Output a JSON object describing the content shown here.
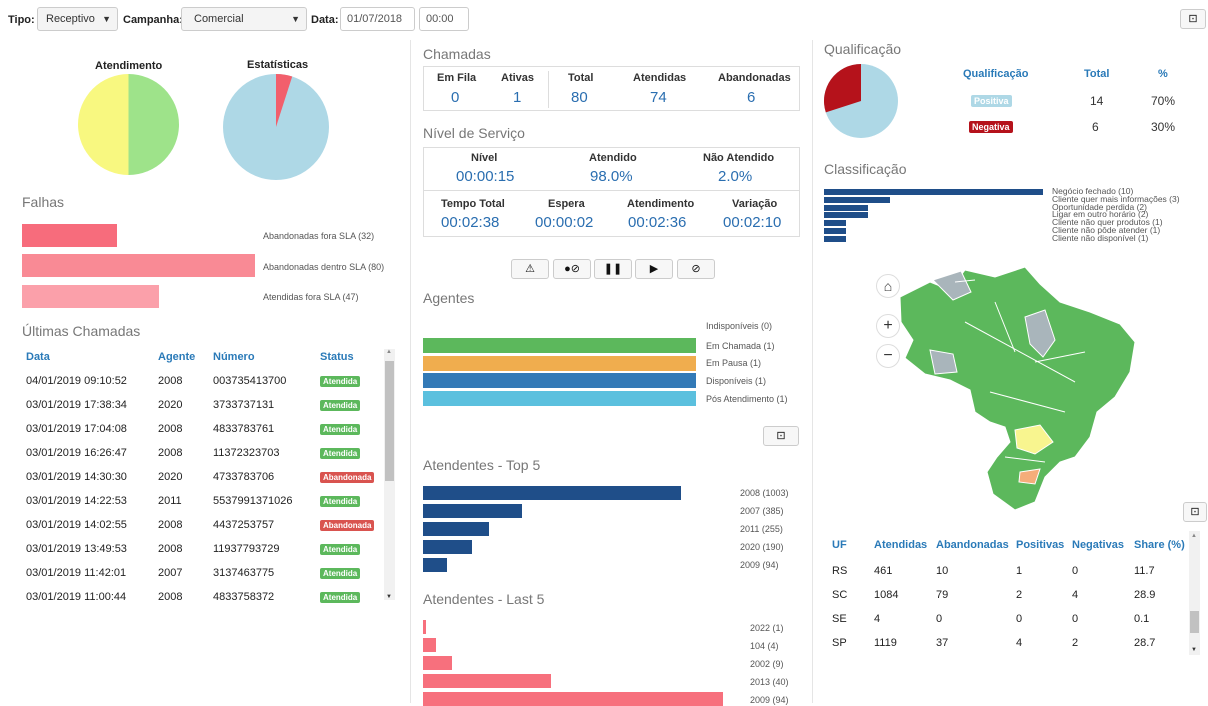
{
  "toolbar": {
    "tipo_label": "Tipo:",
    "tipo_value": "Receptivo",
    "campanha_label": "Campanha:",
    "campanha_value": "Comercial",
    "data_label": "Data:",
    "date_value": "01/07/2018",
    "time_value": "00:00"
  },
  "left": {
    "atendimento_title": "Atendimento",
    "estatisticas_title": "Estatísticas",
    "atendimento_split": [
      0.5,
      0.5
    ],
    "estatisticas_slice": 0.04,
    "falhas_title": "Falhas",
    "falhas": [
      {
        "label": "Abandonadas fora SLA (32)",
        "value": 32
      },
      {
        "label": "Abandonadas dentro SLA (80)",
        "value": 80
      },
      {
        "label": "Atendidas fora SLA (47)",
        "value": 47
      }
    ],
    "ultimas_title": "Últimas Chamadas",
    "headers": [
      "Data",
      "Agente",
      "Número",
      "Status"
    ],
    "rows": [
      [
        "04/01/2019 09:10:52",
        "2008",
        "003735413700",
        "Atendida"
      ],
      [
        "03/01/2019 17:38:34",
        "2020",
        "3733737131",
        "Atendida"
      ],
      [
        "03/01/2019 17:04:08",
        "2008",
        "4833783761",
        "Atendida"
      ],
      [
        "03/01/2019 16:26:47",
        "2008",
        "11372323703",
        "Atendida"
      ],
      [
        "03/01/2019 14:30:30",
        "2020",
        "4733783706",
        "Abandonada"
      ],
      [
        "03/01/2019 14:22:53",
        "2011",
        "5537991371026",
        "Atendida"
      ],
      [
        "03/01/2019 14:02:55",
        "2008",
        "4437253757",
        "Abandonada"
      ],
      [
        "03/01/2019 13:49:53",
        "2008",
        "11937793729",
        "Atendida"
      ],
      [
        "03/01/2019 11:42:01",
        "2007",
        "3137463775",
        "Atendida"
      ],
      [
        "03/01/2019 11:00:44",
        "2008",
        "4833758372",
        "Atendida"
      ]
    ]
  },
  "middle": {
    "chamadas_title": "Chamadas",
    "chamadas": [
      {
        "label": "Em Fila",
        "value": "0"
      },
      {
        "label": "Ativas",
        "value": "1"
      },
      {
        "label": "Total",
        "value": "80"
      },
      {
        "label": "Atendidas",
        "value": "74"
      },
      {
        "label": "Abandonadas",
        "value": "6"
      }
    ],
    "nivel_title": "Nível de Serviço",
    "nivel_row1": [
      {
        "label": "Nível",
        "value": "00:00:15"
      },
      {
        "label": "Atendido",
        "value": "98.0%"
      },
      {
        "label": "Não Atendido",
        "value": "2.0%"
      }
    ],
    "nivel_row2": [
      {
        "label": "Tempo Total",
        "value": "00:02:38"
      },
      {
        "label": "Espera",
        "value": "00:00:02"
      },
      {
        "label": "Atendimento",
        "value": "00:02:36"
      },
      {
        "label": "Variação",
        "value": "00:02:10"
      }
    ],
    "agentes_title": "Agentes",
    "agentes": [
      {
        "label": "Indisponíveis (0)",
        "value": 0,
        "color": "#999999"
      },
      {
        "label": "Em Chamada (1)",
        "value": 1,
        "color": "#5cb85c"
      },
      {
        "label": "Em Pausa (1)",
        "value": 1,
        "color": "#f0ad4e"
      },
      {
        "label": "Disponíveis (1)",
        "value": 1,
        "color": "#337ab7"
      },
      {
        "label": "Pós Atendimento (1)",
        "value": 1,
        "color": "#5bc0de"
      }
    ],
    "top5_title": "Atendentes - Top 5",
    "top5": [
      {
        "label": "2008 (1003)",
        "value": 1003
      },
      {
        "label": "2007 (385)",
        "value": 385
      },
      {
        "label": "2011 (255)",
        "value": 255
      },
      {
        "label": "2020 (190)",
        "value": 190
      },
      {
        "label": "2009 (94)",
        "value": 94
      }
    ],
    "last5_title": "Atendentes - Last 5",
    "last5": [
      {
        "label": "2022 (1)",
        "value": 1
      },
      {
        "label": "104 (4)",
        "value": 4
      },
      {
        "label": "2002 (9)",
        "value": 9
      },
      {
        "label": "2013 (40)",
        "value": 40
      },
      {
        "label": "2009 (94)",
        "value": 94
      }
    ]
  },
  "right": {
    "qualificacao_title": "Qualificação",
    "qual_headers": [
      "Qualificação",
      "Total",
      "%"
    ],
    "qual_rows": [
      {
        "label": "Positiva",
        "total": "14",
        "pct": "70%",
        "color": "#aed8e6"
      },
      {
        "label": "Negativa",
        "total": "6",
        "pct": "30%",
        "color": "#b5121b"
      }
    ],
    "classificacao_title": "Classificação",
    "classificacao": [
      {
        "label": "Negócio fechado (10)",
        "value": 10
      },
      {
        "label": "Cliente quer mais informações (3)",
        "value": 3
      },
      {
        "label": "Oportunidade perdida (2)",
        "value": 2
      },
      {
        "label": "Ligar em outro horário (2)",
        "value": 2
      },
      {
        "label": "Cliente não quer produtos (1)",
        "value": 1
      },
      {
        "label": "Cliente não pôde atender (1)",
        "value": 1
      },
      {
        "label": "Cliente não disponível (1)",
        "value": 1
      }
    ],
    "uf_headers": [
      "UF",
      "Atendidas",
      "Abandonadas",
      "Positivas",
      "Negativas",
      "Share (%)"
    ],
    "uf_rows": [
      [
        "RS",
        "461",
        "10",
        "1",
        "0",
        "11.7"
      ],
      [
        "SC",
        "1084",
        "79",
        "2",
        "4",
        "28.9"
      ],
      [
        "SE",
        "4",
        "0",
        "0",
        "0",
        "0.1"
      ],
      [
        "SP",
        "1119",
        "37",
        "4",
        "2",
        "28.7"
      ]
    ]
  },
  "colors": {
    "accent_blue": "#2a7ab8",
    "falhas": [
      "#f76c7c",
      "#f98a95",
      "#fba0aa"
    ],
    "top5_bar": "#1f4e89",
    "last5_bar": "#f7707d",
    "pie_green": "#9ee38a",
    "pie_yellow": "#f8f880",
    "pie_blue": "#aed8e6",
    "pie_red": "#f25f6c"
  },
  "icons": [
    "caret-down-icon",
    "expand-icon",
    "warning-icon",
    "user-block-icon",
    "pause-icon",
    "play-icon",
    "ban-icon",
    "home-icon",
    "zoom-in-icon",
    "zoom-out-icon"
  ]
}
